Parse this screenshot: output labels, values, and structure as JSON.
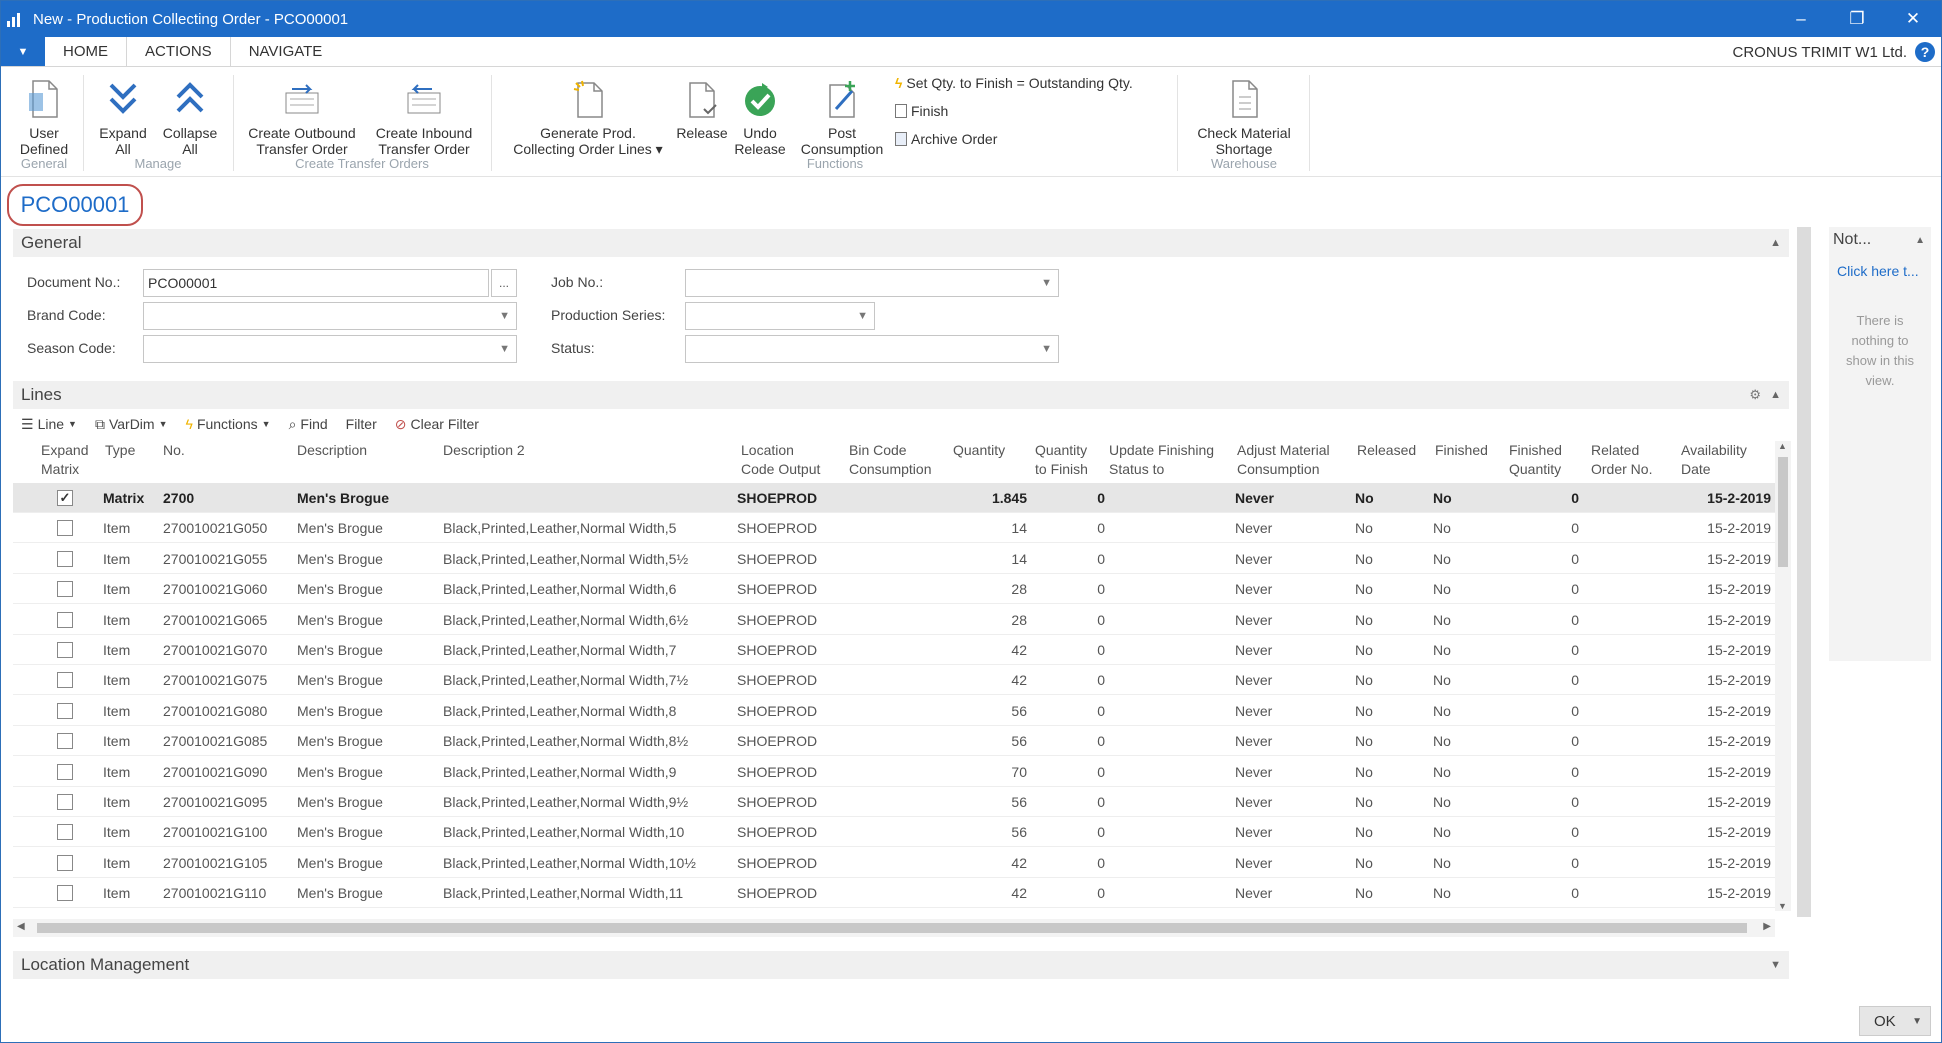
{
  "window": {
    "title": "New - Production Collecting Order - PCO00001",
    "controls": [
      "–",
      "❐",
      "✕"
    ]
  },
  "tabs": [
    "HOME",
    "ACTIONS",
    "NAVIGATE"
  ],
  "company": "CRONUS TRIMIT W1 Ltd.",
  "help": "?",
  "ribbon": {
    "groups": {
      "general": "General",
      "manage": "Manage",
      "transfer": "Create Transfer Orders",
      "functions": "Functions",
      "warehouse": "Warehouse"
    },
    "buttons": {
      "user_defined": [
        "User",
        "Defined"
      ],
      "expand_all": [
        "Expand",
        "All"
      ],
      "collapse_all": [
        "Collapse",
        "All"
      ],
      "create_outbound": [
        "Create Outbound",
        "Transfer Order"
      ],
      "create_inbound": [
        "Create Inbound",
        "Transfer Order"
      ],
      "generate": [
        "Generate Prod.",
        "Collecting Order Lines ▾"
      ],
      "release": [
        "Release",
        ""
      ],
      "undo_release": [
        "Undo",
        "Release"
      ],
      "post_consumption": [
        "Post",
        "Consumption"
      ],
      "check_shortage": [
        "Check Material",
        "Shortage"
      ]
    },
    "small": {
      "set_qty": "Set Qty. to Finish = Outstanding Qty.",
      "finish": "Finish",
      "archive": "Archive Order"
    }
  },
  "page_title": "PCO00001",
  "general": {
    "header": "General",
    "doc_no_label": "Document No.:",
    "doc_no_value": "PCO00001",
    "brand_label": "Brand Code:",
    "season_label": "Season Code:",
    "job_label": "Job No.:",
    "series_label": "Production Series:",
    "status_label": "Status:"
  },
  "lines": {
    "header": "Lines",
    "toolbar": {
      "line": "Line",
      "vardim": "VarDim",
      "functions": "Functions",
      "find": "Find",
      "filter": "Filter",
      "clear_filter": "Clear Filter"
    },
    "columns": [
      [
        "Expand",
        "Matrix"
      ],
      [
        "Type",
        ""
      ],
      [
        "No.",
        ""
      ],
      [
        "Description",
        ""
      ],
      [
        "Description 2",
        ""
      ],
      [
        "Location",
        "Code Output"
      ],
      [
        "Bin Code",
        "Consumption"
      ],
      [
        "Quantity",
        ""
      ],
      [
        "Quantity",
        "to Finish"
      ],
      [
        "Update Finishing",
        "Status to"
      ],
      [
        "Adjust Material",
        "Consumption"
      ],
      [
        "Released",
        ""
      ],
      [
        "Finished",
        ""
      ],
      [
        "Finished",
        "Quantity"
      ],
      [
        "Related",
        "Order No."
      ],
      [
        "Availability",
        "Date"
      ]
    ],
    "rows": [
      {
        "checked": true,
        "type": "Matrix",
        "no": "2700",
        "desc": "Men's Brogue",
        "desc2": "",
        "loc": "SHOEPROD",
        "bin": "",
        "qty": "1.845",
        "qtf": "0",
        "upd": "",
        "adj": "Never",
        "rel": "No",
        "fin": "No",
        "finq": "0",
        "rel_no": "",
        "date": "15-2-2019"
      },
      {
        "checked": false,
        "type": "Item",
        "no": "270010021G050",
        "desc": "Men's Brogue",
        "desc2": "Black,Printed,Leather,Normal Width,5",
        "loc": "SHOEPROD",
        "bin": "",
        "qty": "14",
        "qtf": "0",
        "upd": "",
        "adj": "Never",
        "rel": "No",
        "fin": "No",
        "finq": "0",
        "rel_no": "",
        "date": "15-2-2019"
      },
      {
        "checked": false,
        "type": "Item",
        "no": "270010021G055",
        "desc": "Men's Brogue",
        "desc2": "Black,Printed,Leather,Normal Width,5½",
        "loc": "SHOEPROD",
        "bin": "",
        "qty": "14",
        "qtf": "0",
        "upd": "",
        "adj": "Never",
        "rel": "No",
        "fin": "No",
        "finq": "0",
        "rel_no": "",
        "date": "15-2-2019"
      },
      {
        "checked": false,
        "type": "Item",
        "no": "270010021G060",
        "desc": "Men's Brogue",
        "desc2": "Black,Printed,Leather,Normal Width,6",
        "loc": "SHOEPROD",
        "bin": "",
        "qty": "28",
        "qtf": "0",
        "upd": "",
        "adj": "Never",
        "rel": "No",
        "fin": "No",
        "finq": "0",
        "rel_no": "",
        "date": "15-2-2019"
      },
      {
        "checked": false,
        "type": "Item",
        "no": "270010021G065",
        "desc": "Men's Brogue",
        "desc2": "Black,Printed,Leather,Normal Width,6½",
        "loc": "SHOEPROD",
        "bin": "",
        "qty": "28",
        "qtf": "0",
        "upd": "",
        "adj": "Never",
        "rel": "No",
        "fin": "No",
        "finq": "0",
        "rel_no": "",
        "date": "15-2-2019"
      },
      {
        "checked": false,
        "type": "Item",
        "no": "270010021G070",
        "desc": "Men's Brogue",
        "desc2": "Black,Printed,Leather,Normal Width,7",
        "loc": "SHOEPROD",
        "bin": "",
        "qty": "42",
        "qtf": "0",
        "upd": "",
        "adj": "Never",
        "rel": "No",
        "fin": "No",
        "finq": "0",
        "rel_no": "",
        "date": "15-2-2019"
      },
      {
        "checked": false,
        "type": "Item",
        "no": "270010021G075",
        "desc": "Men's Brogue",
        "desc2": "Black,Printed,Leather,Normal Width,7½",
        "loc": "SHOEPROD",
        "bin": "",
        "qty": "42",
        "qtf": "0",
        "upd": "",
        "adj": "Never",
        "rel": "No",
        "fin": "No",
        "finq": "0",
        "rel_no": "",
        "date": "15-2-2019"
      },
      {
        "checked": false,
        "type": "Item",
        "no": "270010021G080",
        "desc": "Men's Brogue",
        "desc2": "Black,Printed,Leather,Normal Width,8",
        "loc": "SHOEPROD",
        "bin": "",
        "qty": "56",
        "qtf": "0",
        "upd": "",
        "adj": "Never",
        "rel": "No",
        "fin": "No",
        "finq": "0",
        "rel_no": "",
        "date": "15-2-2019"
      },
      {
        "checked": false,
        "type": "Item",
        "no": "270010021G085",
        "desc": "Men's Brogue",
        "desc2": "Black,Printed,Leather,Normal Width,8½",
        "loc": "SHOEPROD",
        "bin": "",
        "qty": "56",
        "qtf": "0",
        "upd": "",
        "adj": "Never",
        "rel": "No",
        "fin": "No",
        "finq": "0",
        "rel_no": "",
        "date": "15-2-2019"
      },
      {
        "checked": false,
        "type": "Item",
        "no": "270010021G090",
        "desc": "Men's Brogue",
        "desc2": "Black,Printed,Leather,Normal Width,9",
        "loc": "SHOEPROD",
        "bin": "",
        "qty": "70",
        "qtf": "0",
        "upd": "",
        "adj": "Never",
        "rel": "No",
        "fin": "No",
        "finq": "0",
        "rel_no": "",
        "date": "15-2-2019"
      },
      {
        "checked": false,
        "type": "Item",
        "no": "270010021G095",
        "desc": "Men's Brogue",
        "desc2": "Black,Printed,Leather,Normal Width,9½",
        "loc": "SHOEPROD",
        "bin": "",
        "qty": "56",
        "qtf": "0",
        "upd": "",
        "adj": "Never",
        "rel": "No",
        "fin": "No",
        "finq": "0",
        "rel_no": "",
        "date": "15-2-2019"
      },
      {
        "checked": false,
        "type": "Item",
        "no": "270010021G100",
        "desc": "Men's Brogue",
        "desc2": "Black,Printed,Leather,Normal Width,10",
        "loc": "SHOEPROD",
        "bin": "",
        "qty": "56",
        "qtf": "0",
        "upd": "",
        "adj": "Never",
        "rel": "No",
        "fin": "No",
        "finq": "0",
        "rel_no": "",
        "date": "15-2-2019"
      },
      {
        "checked": false,
        "type": "Item",
        "no": "270010021G105",
        "desc": "Men's Brogue",
        "desc2": "Black,Printed,Leather,Normal Width,10½",
        "loc": "SHOEPROD",
        "bin": "",
        "qty": "42",
        "qtf": "0",
        "upd": "",
        "adj": "Never",
        "rel": "No",
        "fin": "No",
        "finq": "0",
        "rel_no": "",
        "date": "15-2-2019"
      },
      {
        "checked": false,
        "type": "Item",
        "no": "270010021G110",
        "desc": "Men's Brogue",
        "desc2": "Black,Printed,Leather,Normal Width,11",
        "loc": "SHOEPROD",
        "bin": "",
        "qty": "42",
        "qtf": "0",
        "upd": "",
        "adj": "Never",
        "rel": "No",
        "fin": "No",
        "finq": "0",
        "rel_no": "",
        "date": "15-2-2019"
      }
    ]
  },
  "location_management": "Location Management",
  "factbox": {
    "title": "Not...",
    "link": "Click here t...",
    "empty": "There is nothing to show in this view."
  },
  "ok": "OK",
  "icons": {
    "app": "chart-icon",
    "menu": "dropdown-triangle-icon",
    "help": "help-circle-icon"
  },
  "colors": {
    "accent": "#1e6cc8",
    "highlight_ring": "#c0504d",
    "selected_row": "#e6e6e6"
  }
}
